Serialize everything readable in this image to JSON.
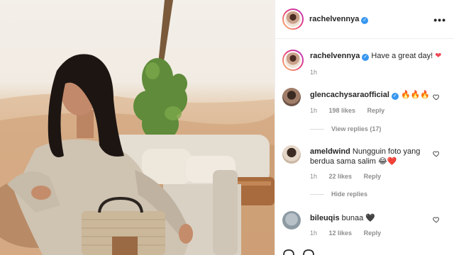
{
  "post": {
    "author": "rachelvennya",
    "more_icon": "more-horizontal-icon",
    "caption": {
      "username": "rachelvennya",
      "text": "Have a great day!",
      "emoji": "❤️",
      "age": "1h"
    }
  },
  "comments": [
    {
      "username": "glencachysaraofficial",
      "text": "🔥🔥🔥",
      "age": "1h",
      "likes": "198 likes",
      "reply": "Reply",
      "replies_toggle": "View replies (17)"
    },
    {
      "username": "ameldwind",
      "text": "Nungguin foto yang berdua sama salim 😂❤️",
      "text_line1": "Nungguin foto yang",
      "text_line2": "berdua sama salim 😂❤️",
      "age": "1h",
      "likes": "22 likes",
      "reply": "Reply",
      "replies_toggle": "Hide replies"
    },
    {
      "username": "bileuqis",
      "text": "bunaa 🖤",
      "age": "1h",
      "likes": "12 likes",
      "reply": "Reply"
    }
  ],
  "colors": {
    "verified": "#3897f0",
    "heart_red": "#ed4956",
    "muted": "#8e8e8e",
    "text": "#262626",
    "border": "#efefef"
  }
}
